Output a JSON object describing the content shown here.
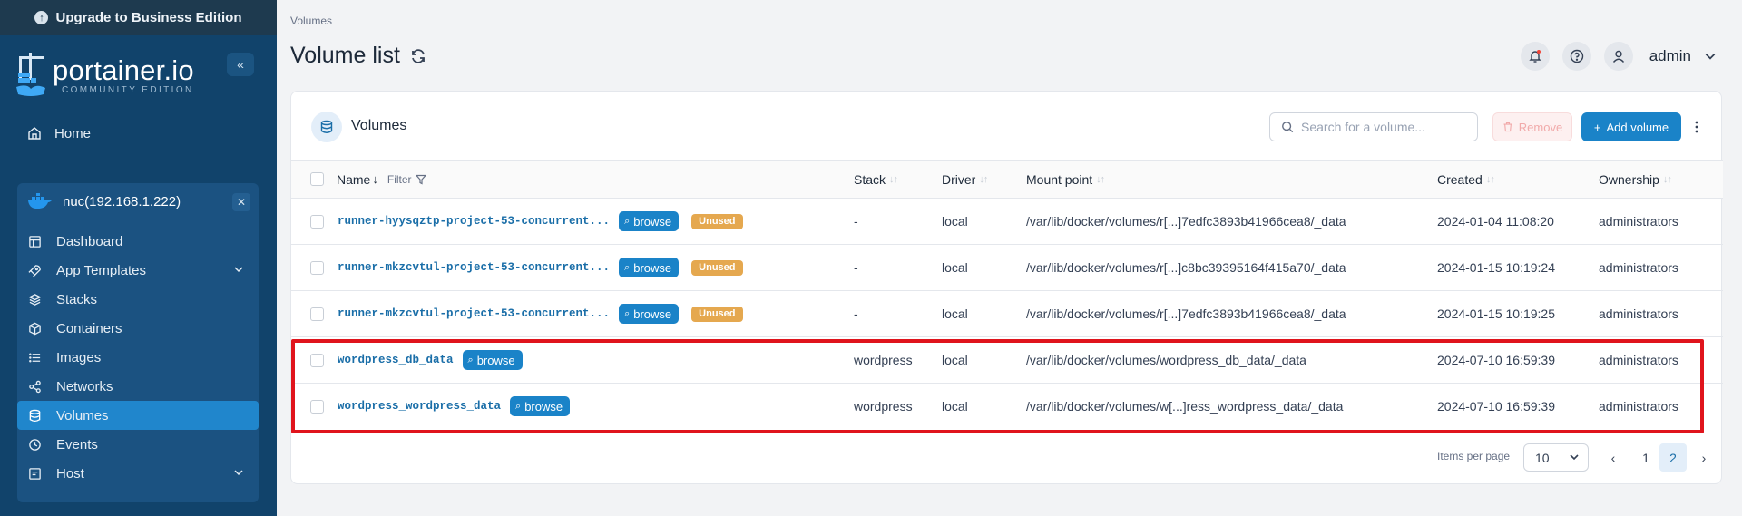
{
  "sidebar": {
    "upgrade_label": "Upgrade to Business Edition",
    "logo_text": "portainer.io",
    "logo_subtitle": "COMMUNITY EDITION",
    "home_label": "Home",
    "environment": {
      "name": "nuc(192.168.1.222)",
      "items": [
        {
          "label": "Dashboard",
          "icon": "dashboard-icon"
        },
        {
          "label": "App Templates",
          "icon": "rocket-icon",
          "expandable": true
        },
        {
          "label": "Stacks",
          "icon": "stacks-icon"
        },
        {
          "label": "Containers",
          "icon": "box-icon"
        },
        {
          "label": "Images",
          "icon": "list-icon"
        },
        {
          "label": "Networks",
          "icon": "share-icon"
        },
        {
          "label": "Volumes",
          "icon": "database-icon",
          "active": true
        },
        {
          "label": "Events",
          "icon": "clock-icon"
        },
        {
          "label": "Host",
          "icon": "server-icon",
          "expandable": true
        }
      ]
    }
  },
  "header": {
    "breadcrumb": "Volumes",
    "title": "Volume list",
    "user": "admin"
  },
  "card": {
    "title": "Volumes",
    "search_placeholder": "Search for a volume...",
    "remove_label": "Remove",
    "add_label": "Add volume"
  },
  "table": {
    "columns": {
      "name": "Name",
      "filter": "Filter",
      "stack": "Stack",
      "driver": "Driver",
      "mount": "Mount point",
      "created": "Created",
      "ownership": "Ownership"
    },
    "browse_label": "browse",
    "unused_label": "Unused",
    "rows": [
      {
        "name": "runner-hyysqztp-project-53-concurrent...",
        "unused": true,
        "stack": "-",
        "driver": "local",
        "mount": "/var/lib/docker/volumes/r[...]7edfc3893b41966cea8/_data",
        "created": "2024-01-04 11:08:20",
        "ownership": "administrators"
      },
      {
        "name": "runner-mkzcvtul-project-53-concurrent...",
        "unused": true,
        "stack": "-",
        "driver": "local",
        "mount": "/var/lib/docker/volumes/r[...]c8bc39395164f415a70/_data",
        "created": "2024-01-15 10:19:24",
        "ownership": "administrators"
      },
      {
        "name": "runner-mkzcvtul-project-53-concurrent...",
        "unused": true,
        "stack": "-",
        "driver": "local",
        "mount": "/var/lib/docker/volumes/r[...]7edfc3893b41966cea8/_data",
        "created": "2024-01-15 10:19:25",
        "ownership": "administrators"
      },
      {
        "name": "wordpress_db_data",
        "unused": false,
        "stack": "wordpress",
        "driver": "local",
        "mount": "/var/lib/docker/volumes/wordpress_db_data/_data",
        "created": "2024-07-10 16:59:39",
        "ownership": "administrators"
      },
      {
        "name": "wordpress_wordpress_data",
        "unused": false,
        "stack": "wordpress",
        "driver": "local",
        "mount": "/var/lib/docker/volumes/w[...]ress_wordpress_data/_data",
        "created": "2024-07-10 16:59:39",
        "ownership": "administrators"
      }
    ]
  },
  "pagination": {
    "items_per_page_label": "Items per page",
    "page_size": "10",
    "prev": "‹",
    "next": "›",
    "pages": [
      "1",
      "2"
    ],
    "current_page": "2"
  },
  "colors": {
    "sidebar_bg": "#11436b",
    "accent": "#1a83c8",
    "unused_badge": "#e5a84f",
    "highlight_border": "#e0141c"
  }
}
